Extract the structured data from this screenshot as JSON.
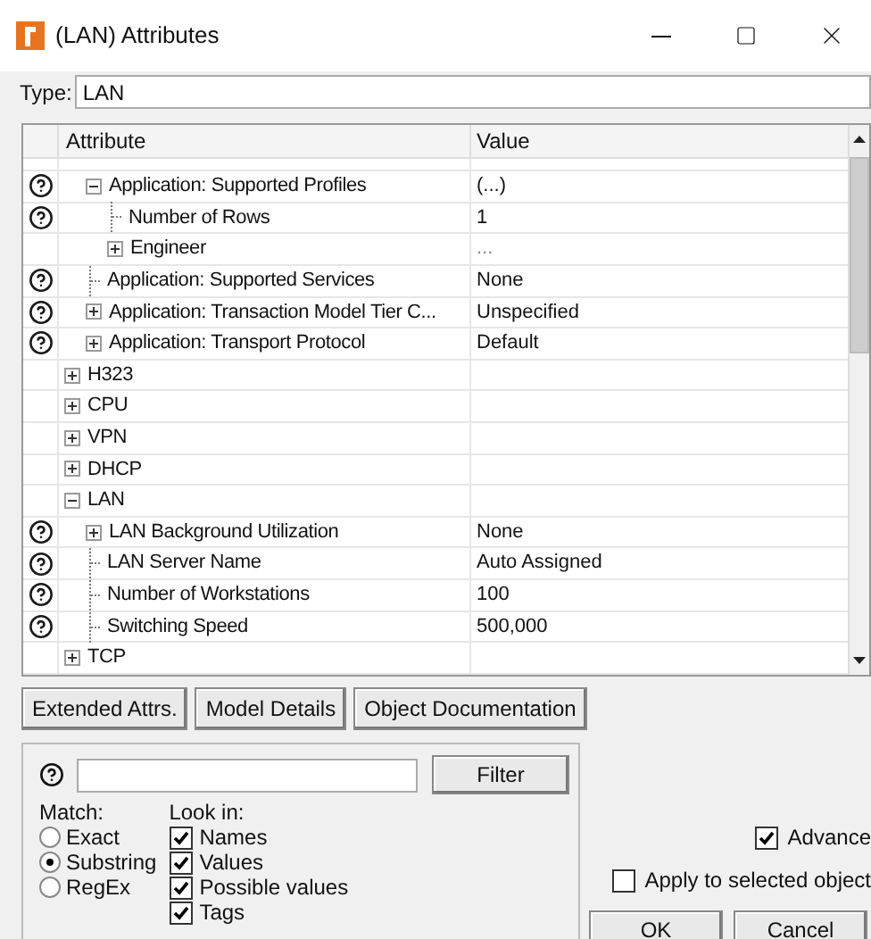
{
  "window": {
    "title": "(LAN) Attributes"
  },
  "type_field": {
    "label": "Type:",
    "value": "LAN"
  },
  "table": {
    "columns": [
      "Attribute",
      "Value"
    ],
    "application_rows": [
      {
        "label": "Application: Supported Profiles",
        "value": "(...)",
        "help": true,
        "expanded": true,
        "children": [
          {
            "label": "Number of Rows",
            "value": "1",
            "help": true
          },
          {
            "label": "Engineer",
            "value": "...",
            "help": false,
            "expanded": false
          }
        ]
      },
      {
        "label": "Application: Supported Services",
        "value": "None",
        "help": true
      },
      {
        "label": "Application: Transaction Model Tier C...",
        "value": "Unspecified",
        "help": true,
        "expanded": false
      },
      {
        "label": "Application: Transport Protocol",
        "value": "Default",
        "help": true,
        "expanded": false
      }
    ],
    "rows": [
      {
        "label": "H323",
        "help": false,
        "expanded": false
      },
      {
        "label": "CPU",
        "help": false,
        "expanded": false
      },
      {
        "label": "VPN",
        "help": false,
        "expanded": false
      },
      {
        "label": "DHCP",
        "help": false,
        "expanded": false
      },
      {
        "label": "LAN",
        "help": false,
        "expanded": true,
        "children": [
          {
            "label": "LAN Background Utilization",
            "value": "None",
            "help": true,
            "expanded": false
          },
          {
            "label": "LAN Server Name",
            "value": "Auto Assigned",
            "help": true
          },
          {
            "label": "Number of Workstations",
            "value": "100",
            "help": true
          },
          {
            "label": "Switching Speed",
            "value": "500,000",
            "help": true
          }
        ]
      },
      {
        "label": "TCP",
        "help": false,
        "expanded": false
      }
    ]
  },
  "buttons": [
    "Extended Attrs.",
    "Model Details",
    "Object Documentation"
  ],
  "filter": {
    "button": "Filter",
    "match_label": "Match:",
    "match_options": [
      {
        "label": "Exact",
        "selected": false
      },
      {
        "label": "Substring",
        "selected": true
      },
      {
        "label": "RegEx",
        "selected": false
      }
    ],
    "look_in_label": "Look in:",
    "look_in": [
      {
        "label": "Names",
        "checked": true
      },
      {
        "label": "Values",
        "checked": true
      },
      {
        "label": "Possible values",
        "checked": true
      },
      {
        "label": "Tags",
        "checked": true
      }
    ]
  },
  "advanced": {
    "label": "Advance",
    "checked": true
  },
  "apply": {
    "label": "Apply to selected object",
    "checked": false
  },
  "dialog_buttons": [
    "OK",
    "Cancel"
  ]
}
